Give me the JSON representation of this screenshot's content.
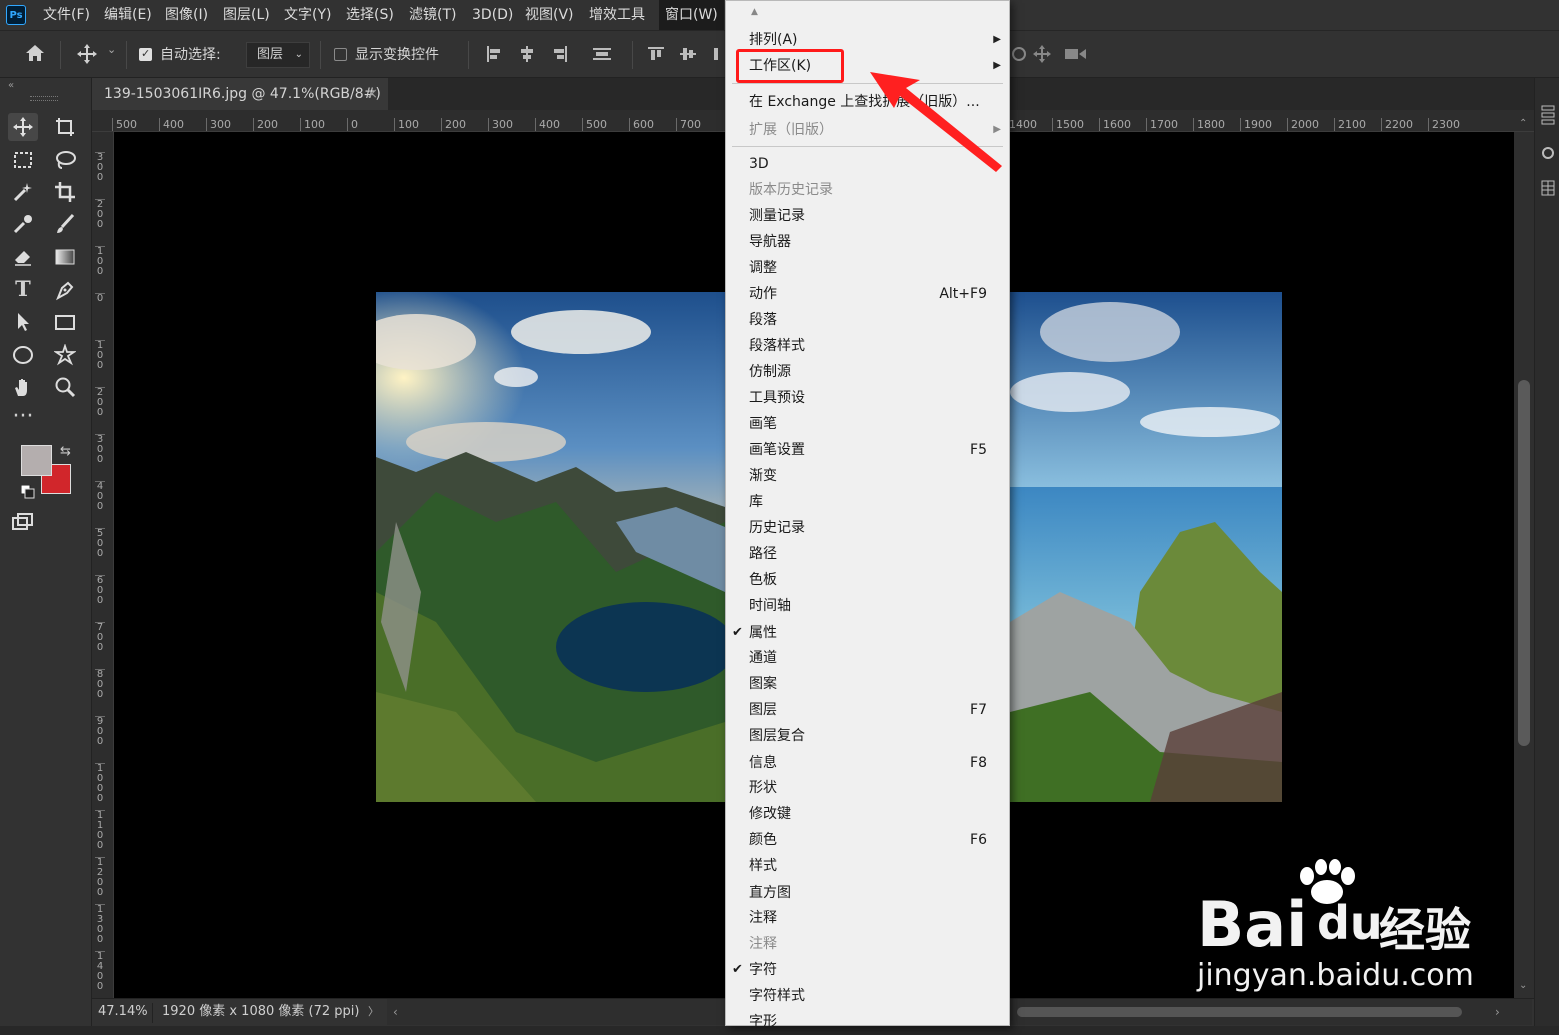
{
  "app": {
    "logo_text": "Ps"
  },
  "menubar": {
    "items": [
      "文件(F)",
      "编辑(E)",
      "图像(I)",
      "图层(L)",
      "文字(Y)",
      "选择(S)",
      "滤镜(T)",
      "3D(D)",
      "视图(V)",
      "增效工具",
      "窗口(W)"
    ],
    "active": "窗口(W)"
  },
  "options_bar": {
    "auto_select_label": "自动选择:",
    "auto_select_checked": true,
    "auto_select_target": "图层",
    "show_transform_label": "显示变换控件",
    "show_transform_checked": false
  },
  "document": {
    "tab_title": "139-1503061IR6.jpg @ 47.1%(RGB/8#)",
    "close_glyph": "×"
  },
  "ruler": {
    "h_labels": [
      "500",
      "400",
      "300",
      "200",
      "100",
      "0",
      "100",
      "200",
      "300",
      "400",
      "500",
      "600",
      "700",
      "1400",
      "1500",
      "1600",
      "1700",
      "1800",
      "1900",
      "2000",
      "2100",
      "2200",
      "2300"
    ],
    "v_labels": [
      "300",
      "200",
      "100",
      "0",
      "100",
      "200",
      "300",
      "400",
      "500",
      "600",
      "700",
      "800",
      "900",
      "1000",
      "1100",
      "1200",
      "1300",
      "1400"
    ]
  },
  "status": {
    "zoom": "47.14%",
    "doc_info": "1920 像素 x 1080 像素 (72 ppi)",
    "arrow": "〉"
  },
  "window_menu": {
    "items": [
      {
        "label": "排列(A)",
        "submenu": true
      },
      {
        "label": "工作区(K)",
        "submenu": true,
        "highlighted": true
      },
      {
        "separator": true
      },
      {
        "label": "在 Exchange 上查找扩展（旧版）..."
      },
      {
        "label": "扩展（旧版）",
        "submenu": true,
        "disabled": true
      },
      {
        "separator": true
      },
      {
        "label": "3D"
      },
      {
        "label": "版本历史记录",
        "disabled": true
      },
      {
        "label": "测量记录"
      },
      {
        "label": "导航器"
      },
      {
        "label": "调整"
      },
      {
        "label": "动作",
        "shortcut": "Alt+F9"
      },
      {
        "label": "段落"
      },
      {
        "label": "段落样式"
      },
      {
        "label": "仿制源"
      },
      {
        "label": "工具预设"
      },
      {
        "label": "画笔"
      },
      {
        "label": "画笔设置",
        "shortcut": "F5"
      },
      {
        "label": "渐变"
      },
      {
        "label": "库"
      },
      {
        "label": "历史记录"
      },
      {
        "label": "路径"
      },
      {
        "label": "色板"
      },
      {
        "label": "时间轴"
      },
      {
        "label": "属性",
        "checked": true
      },
      {
        "label": "通道"
      },
      {
        "label": "图案"
      },
      {
        "label": "图层",
        "shortcut": "F7"
      },
      {
        "label": "图层复合"
      },
      {
        "label": "信息",
        "shortcut": "F8"
      },
      {
        "label": "形状"
      },
      {
        "label": "修改键"
      },
      {
        "label": "颜色",
        "shortcut": "F6"
      },
      {
        "label": "样式"
      },
      {
        "label": "直方图"
      },
      {
        "label": "注释"
      },
      {
        "label": "注释",
        "disabled": true
      },
      {
        "label": "字符",
        "checked": true
      },
      {
        "label": "字符样式"
      },
      {
        "label": "字形"
      }
    ]
  },
  "watermark": {
    "brand": "Bai",
    "brand2": "du",
    "cn": "经验",
    "url": "jingyan.baidu.com"
  },
  "colors": {
    "foreground": "#b4aeae",
    "background": "#d1262b",
    "highlight": "#ff1a1a",
    "accent": "#31a8ff"
  },
  "icons": [
    "home-icon",
    "move-icon",
    "align-left-icon",
    "align-center-icon",
    "align-right-icon",
    "distribute-icon",
    "marquee-icon",
    "lasso-icon",
    "magic-wand-icon",
    "crop-icon",
    "eyedropper-icon",
    "brush-icon",
    "eraser-icon",
    "gradient-icon",
    "type-icon",
    "pen-icon",
    "path-select-icon",
    "rectangle-icon",
    "ellipse-icon",
    "custom-shape-icon",
    "hand-icon",
    "zoom-icon",
    "more-icon",
    "swap-icon",
    "default-colors-icon",
    "screen-mode-icon",
    "submenu-arrow-icon",
    "checkmark-icon"
  ]
}
